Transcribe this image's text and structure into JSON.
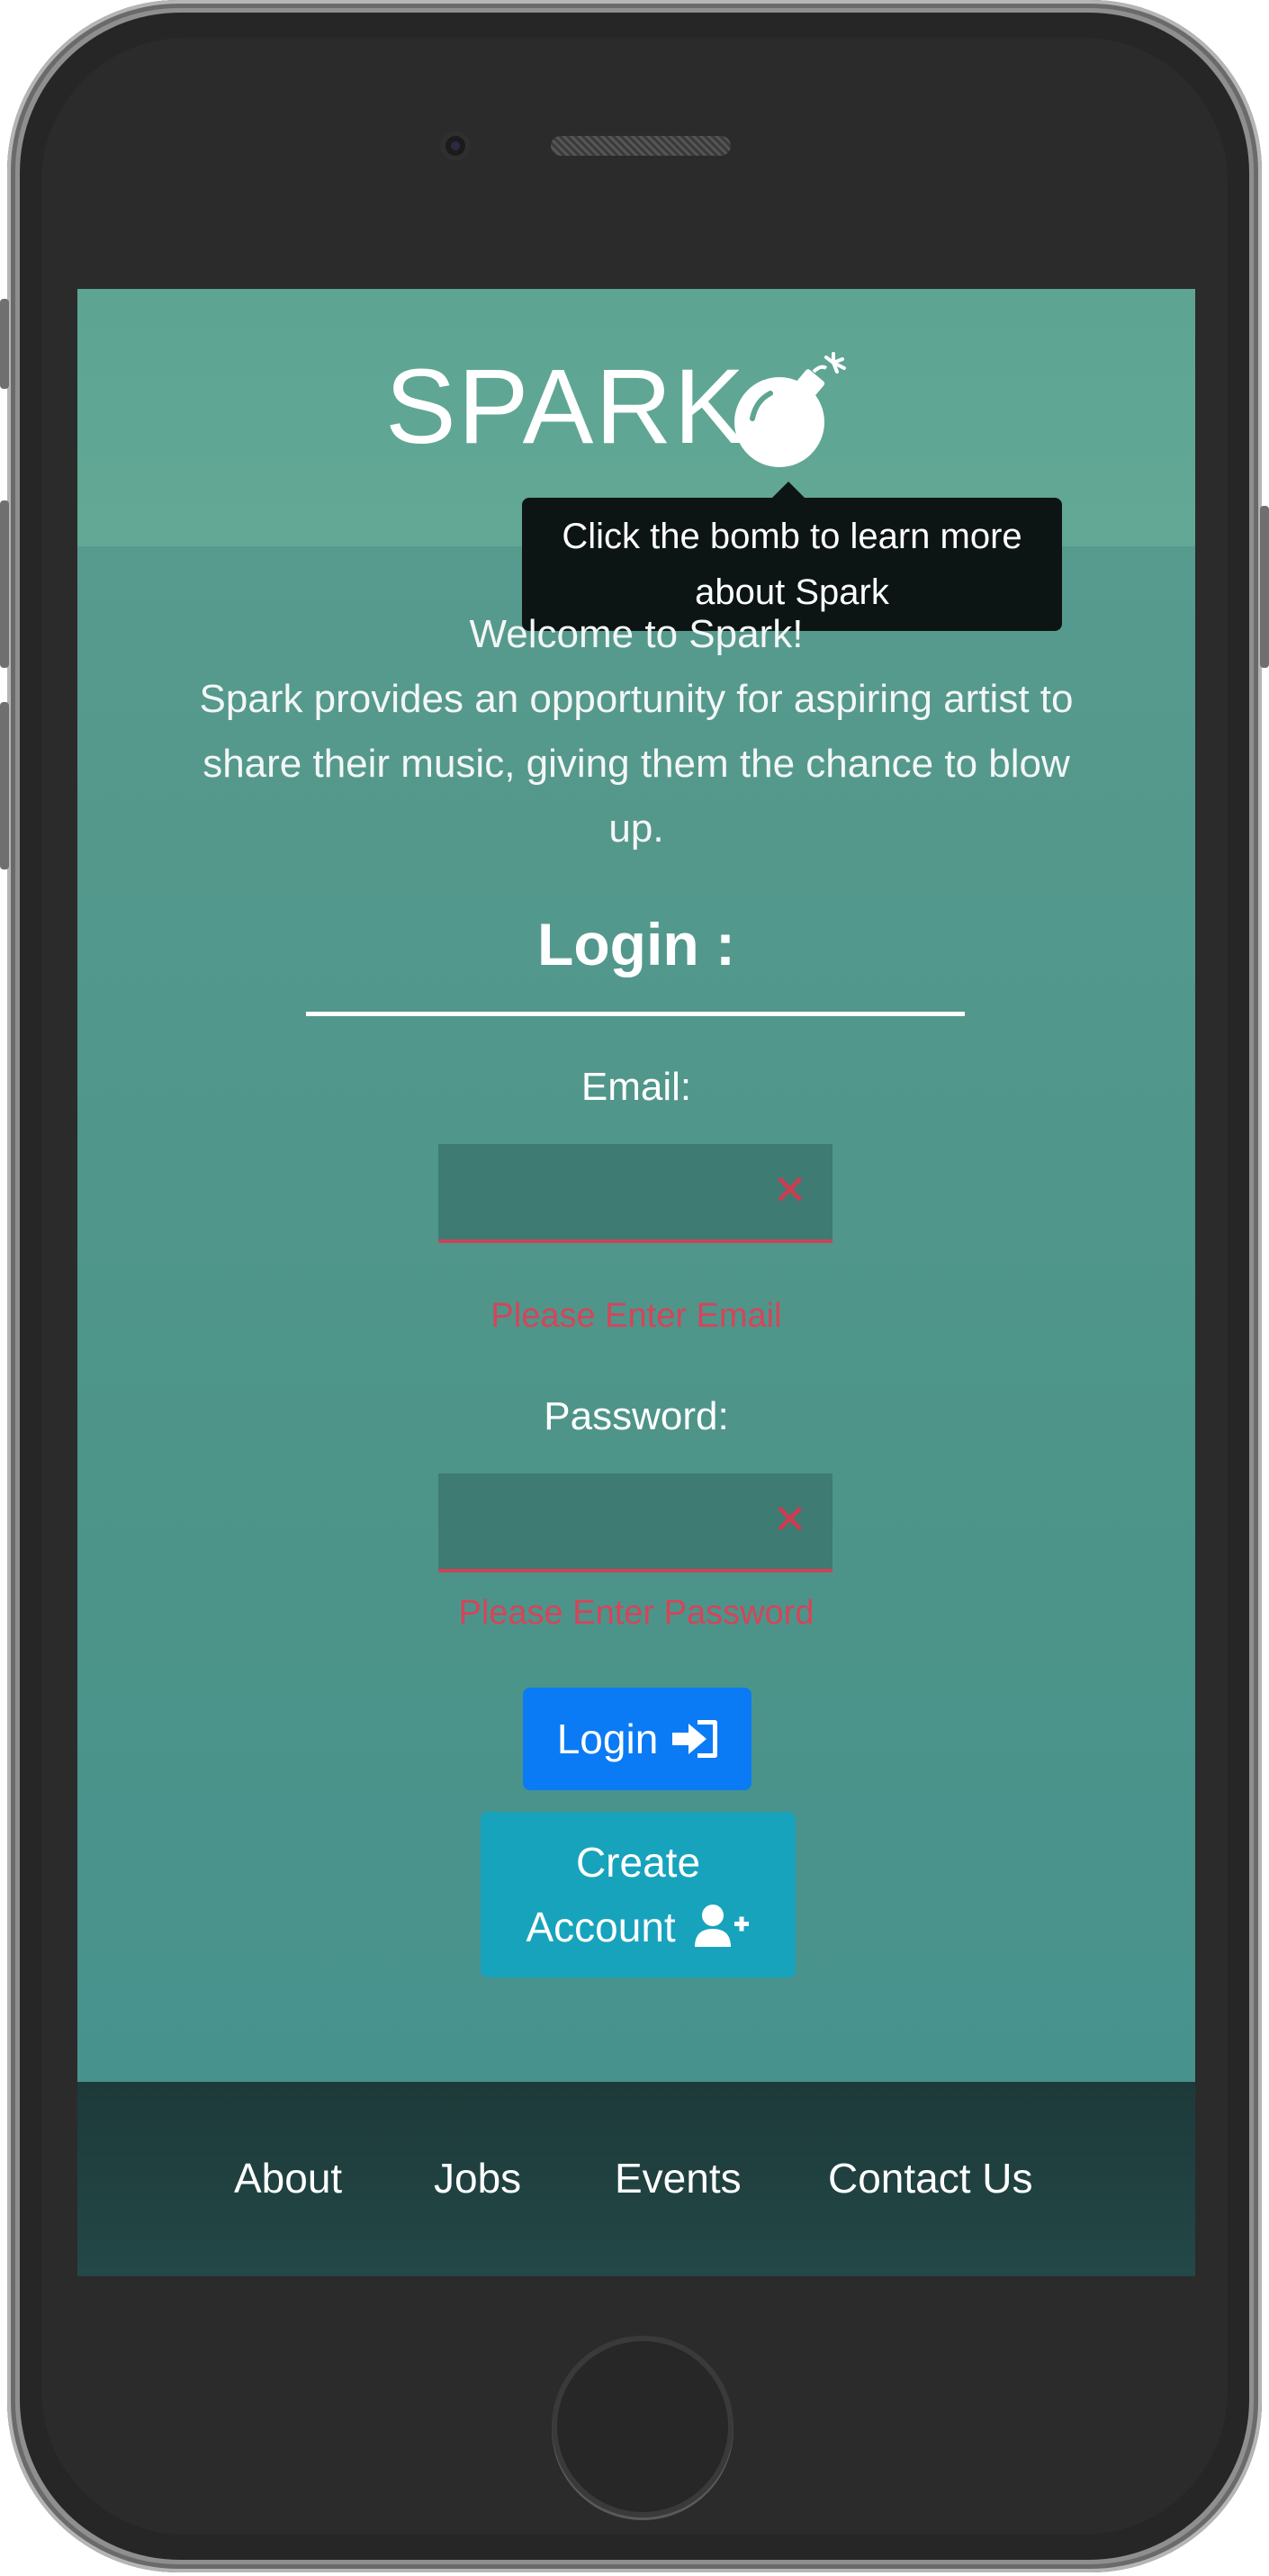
{
  "header": {
    "logo_text": "SPARK",
    "tooltip_line1": "Click the bomb to learn more",
    "tooltip_line2": "about Spark"
  },
  "intro": {
    "line1": "Welcome to Spark!",
    "line2": "Spark provides an opportunity for aspiring artist to",
    "line3": "share their music, giving them the chance to blow",
    "line4": "up."
  },
  "login": {
    "title": "Login :",
    "email_label": "Email:",
    "email_value": "",
    "email_error": "Please Enter Email",
    "password_label": "Password:",
    "password_value": "",
    "password_error": "Please Enter Password",
    "login_button": "Login",
    "create_line1": "Create",
    "create_line2": "Account"
  },
  "footer": {
    "links": [
      "About",
      "Jobs",
      "Events",
      "Contact Us"
    ]
  },
  "colors": {
    "accent_login": "#0a7bf5",
    "accent_create": "#18a3bd",
    "error": "#d4455a",
    "background": "#50988b",
    "footer": "#204443"
  },
  "icons": [
    "bomb-icon",
    "sign-in-icon",
    "user-plus-icon",
    "clear-icon"
  ]
}
